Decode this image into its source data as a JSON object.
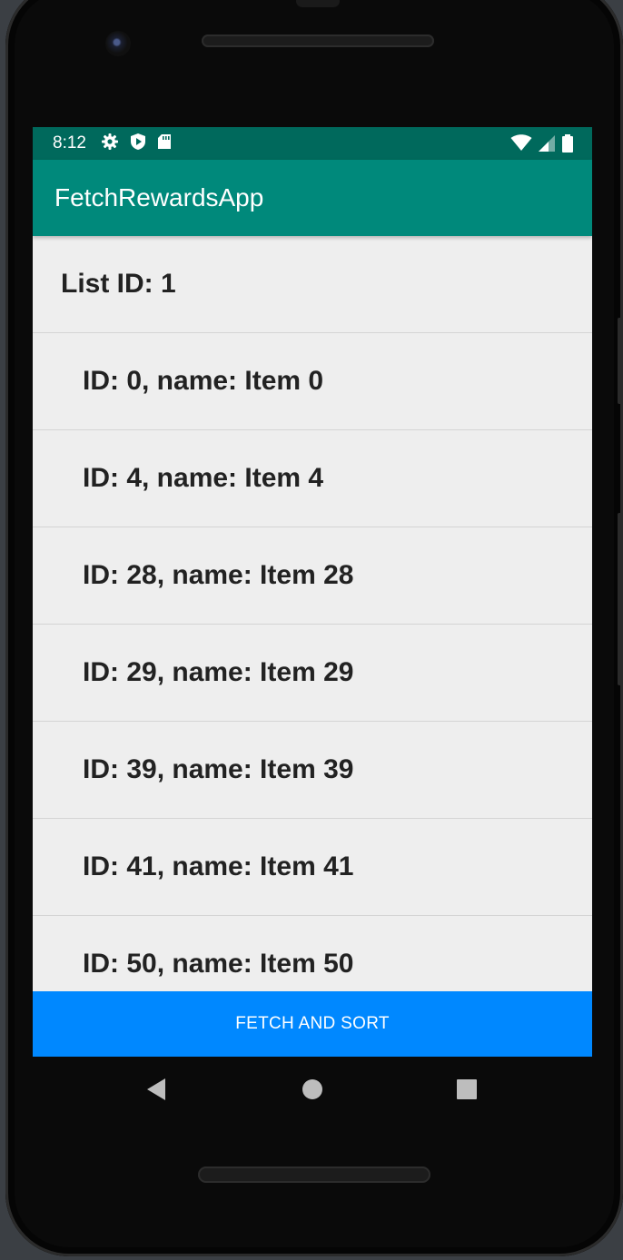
{
  "status_bar": {
    "time": "8:12",
    "left_icons": [
      "gear-icon",
      "shield-icon",
      "sd-card-icon"
    ],
    "right_icons": [
      "wifi-icon",
      "signal-icon",
      "battery-icon"
    ]
  },
  "app_bar": {
    "title": "FetchRewardsApp",
    "color": "#00897b",
    "status_color": "#00695c"
  },
  "list": {
    "header": "List ID: 1",
    "items": [
      "ID: 0, name: Item 0",
      "ID: 4, name: Item 4",
      "ID: 28, name: Item 28",
      "ID: 29, name: Item 29",
      "ID: 39, name: Item 39",
      "ID: 41, name: Item 41",
      "ID: 50, name: Item 50"
    ]
  },
  "fetch_button": {
    "label": "FETCH AND SORT",
    "color": "#0088ff"
  },
  "nav": {
    "buttons": [
      "back-icon",
      "home-icon",
      "recents-icon"
    ]
  }
}
